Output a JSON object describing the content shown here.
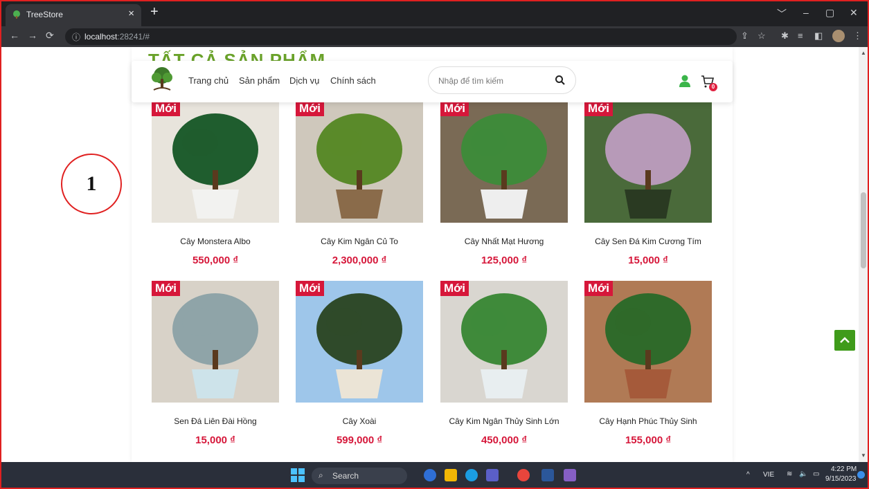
{
  "browser": {
    "tab_title": "TreeStore",
    "tab_close": "×",
    "new_tab": "+",
    "url_host": "localhost",
    "url_rest": ":28241/#",
    "window_controls": [
      "﹀",
      "–",
      "▢",
      "✕"
    ]
  },
  "annotation": {
    "number": "1"
  },
  "page": {
    "section_title": "TẤT CẢ SẢN PHẨM",
    "nav": {
      "links": [
        "Trang chủ",
        "Sản phẩm",
        "Dịch vụ",
        "Chính sách"
      ],
      "search_placeholder": "Nhập để tìm kiếm",
      "cart_count": "0"
    },
    "badge_label": "Mới",
    "products": [
      {
        "name": "Cây Monstera Albo",
        "price": "550,000 ₫"
      },
      {
        "name": "Cây Kim Ngân Củ To",
        "price": "2,300,000 ₫"
      },
      {
        "name": "Cây Nhất Mạt Hương",
        "price": "125,000 ₫"
      },
      {
        "name": "Cây Sen Đá Kim Cương Tím",
        "price": "15,000 ₫"
      },
      {
        "name": "Sen Đá Liên Đài Hồng",
        "price": "15,000 ₫"
      },
      {
        "name": "Cây Xoài",
        "price": "599,000 ₫"
      },
      {
        "name": "Cây Kim Ngân Thủy Sinh Lớn",
        "price": "450,000 ₫"
      },
      {
        "name": "Cây Hạnh Phúc Thủy Sinh",
        "price": "155,000 ₫"
      }
    ]
  },
  "taskbar": {
    "search_label": "Search",
    "lang": "VIE",
    "time": "4:22 PM",
    "date": "9/15/2023"
  },
  "colors": {
    "accent_green": "#6aa22a",
    "price_red": "#d6173a",
    "to_top_green": "#3f9b1a"
  }
}
